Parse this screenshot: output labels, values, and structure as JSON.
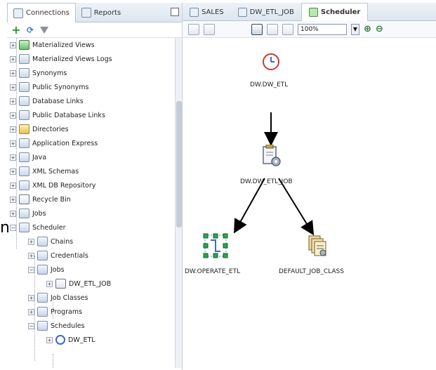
{
  "left_panel": {
    "tabs": [
      {
        "label": "Connections",
        "active": true
      },
      {
        "label": "Reports",
        "active": false
      }
    ],
    "tree": [
      {
        "label": "Materialized Views",
        "icon": "materialized-view-icon"
      },
      {
        "label": "Materialized Views Logs",
        "icon": "materialized-view-log-icon"
      },
      {
        "label": "Synonyms",
        "icon": "synonyms-icon"
      },
      {
        "label": "Public Synonyms",
        "icon": "public-synonyms-icon"
      },
      {
        "label": "Database Links",
        "icon": "database-links-icon"
      },
      {
        "label": "Public Database Links",
        "icon": "public-database-links-icon"
      },
      {
        "label": "Directories",
        "icon": "directories-icon"
      },
      {
        "label": "Application Express",
        "icon": "application-express-icon"
      },
      {
        "label": "Java",
        "icon": "java-icon"
      },
      {
        "label": "XML Schemas",
        "icon": "xml-schemas-icon"
      },
      {
        "label": "XML DB Repository",
        "icon": "xml-db-repository-icon"
      },
      {
        "label": "Recycle Bin",
        "icon": "recycle-bin-icon"
      },
      {
        "label": "Jobs",
        "icon": "jobs-icon"
      },
      {
        "label": "Scheduler",
        "icon": "scheduler-icon"
      },
      {
        "label": "Chains",
        "icon": "chains-icon"
      },
      {
        "label": "Credentials",
        "icon": "credentials-icon"
      },
      {
        "label": "Jobs",
        "icon": "jobs-folder-icon"
      },
      {
        "label": "DW_ETL_JOB",
        "icon": "job-icon"
      },
      {
        "label": "Job Classes",
        "icon": "job-classes-icon"
      },
      {
        "label": "Programs",
        "icon": "programs-icon"
      },
      {
        "label": "Schedules",
        "icon": "schedules-icon"
      },
      {
        "label": "DW_ETL",
        "icon": "schedule-icon"
      }
    ]
  },
  "right_panel": {
    "tabs": [
      {
        "label": "SALES",
        "active": false
      },
      {
        "label": "DW_ETL_JOB",
        "active": false
      },
      {
        "label": "Scheduler",
        "active": true
      }
    ],
    "zoom": "100%",
    "nodes": {
      "schedule": "DW.DW_ETL",
      "job": "DW.DW_ETL_JOB",
      "program": "DW.OPERATE_ETL",
      "job_class": "DEFAULT_JOB_CLASS"
    }
  },
  "colors": {
    "arrow": "#000000",
    "clock": "#c83a3a",
    "program_green": "#2aa84a"
  },
  "cutoff_text": "n"
}
